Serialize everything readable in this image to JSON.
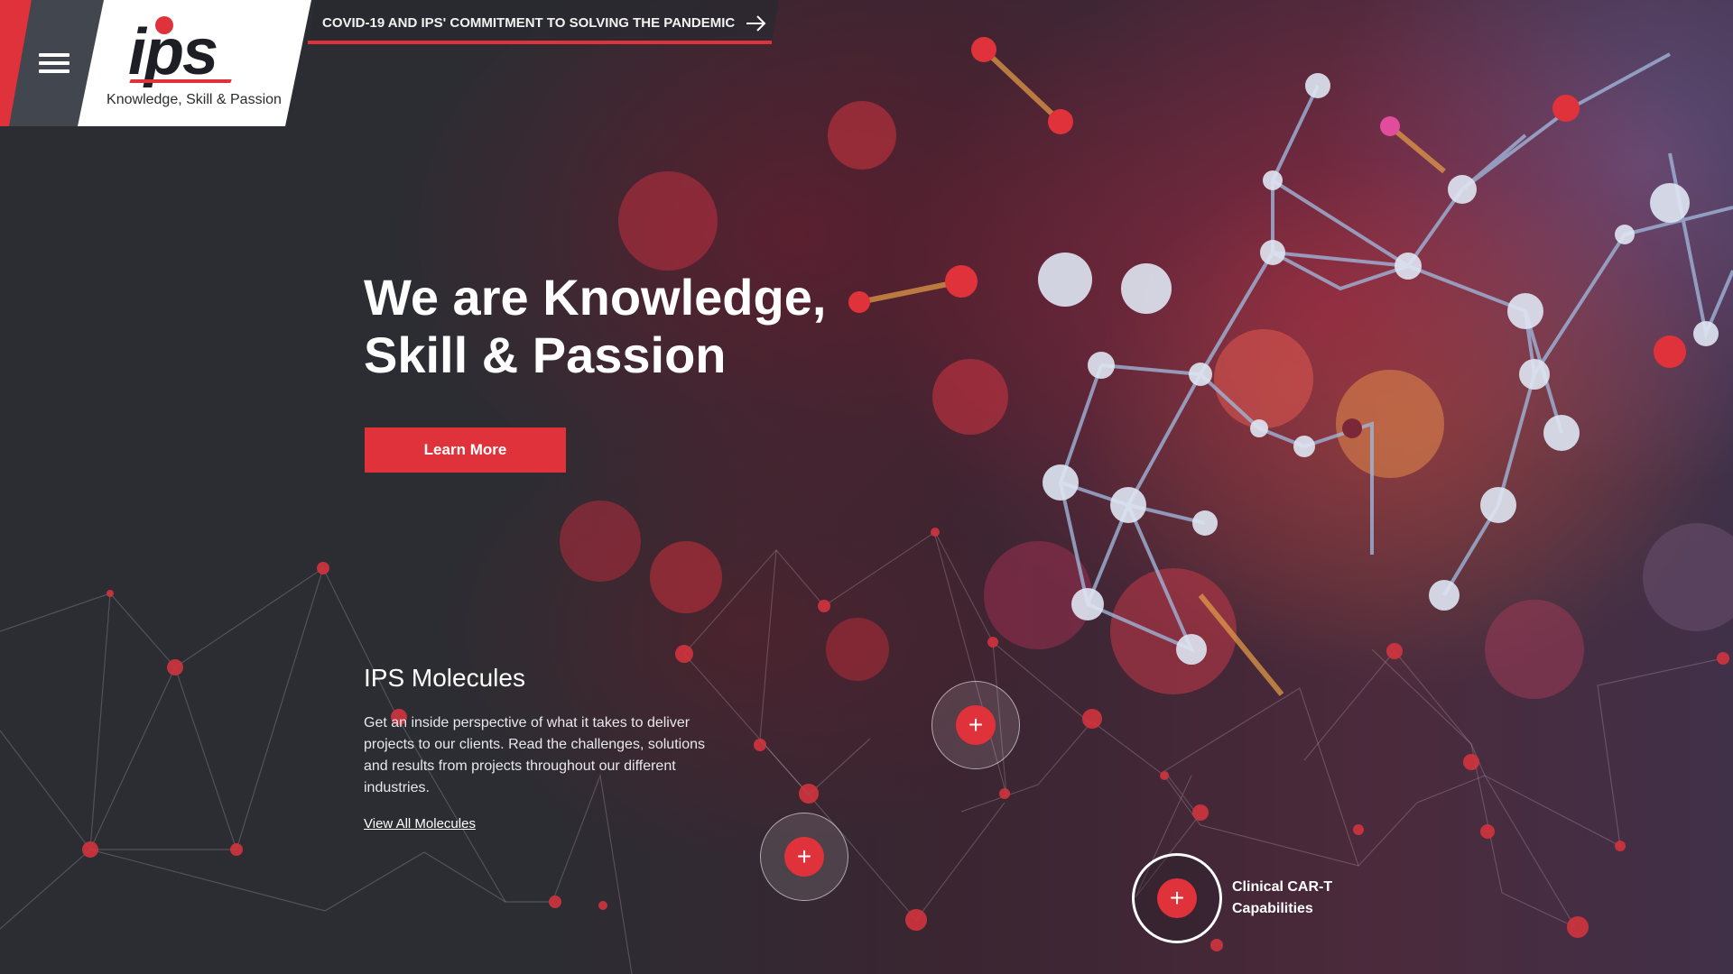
{
  "header": {
    "menu_icon": "hamburger-menu-icon",
    "logo_text": "ips",
    "logo_tagline": "Knowledge, Skill & Passion",
    "announcement": "COVID-19 AND IPS' COMMITMENT TO SOLVING THE PANDEMIC",
    "announcement_icon": "arrow-right-icon"
  },
  "hero": {
    "title_line1": "We are Knowledge,",
    "title_line2": "Skill & Passion",
    "cta_label": "Learn More"
  },
  "molecules": {
    "title": "IPS Molecules",
    "description": "Get an inside perspective of what it takes to deliver projects to our clients. Read the challenges, solutions and results from projects throughout our different industries.",
    "link_label": "View All Molecules"
  },
  "hotspots": {
    "icon": "plus-icon",
    "symbol": "+",
    "featured_label": "Clinical CAR-T Capabilities"
  },
  "colors": {
    "accent": "#e0323a",
    "background": "#2b2d33",
    "header_dark": "#42464e"
  }
}
